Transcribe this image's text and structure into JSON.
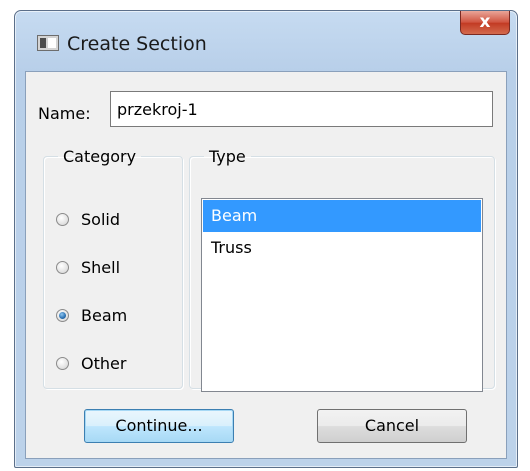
{
  "window": {
    "title": "Create Section",
    "close_label": "x"
  },
  "name_field": {
    "label": "Name:",
    "value": "przekroj-1"
  },
  "category": {
    "legend": "Category",
    "options": [
      {
        "label": "Solid",
        "checked": false
      },
      {
        "label": "Shell",
        "checked": false
      },
      {
        "label": "Beam",
        "checked": true
      },
      {
        "label": "Other",
        "checked": false
      }
    ]
  },
  "type": {
    "legend": "Type",
    "items": [
      {
        "label": "Beam",
        "selected": true
      },
      {
        "label": "Truss",
        "selected": false
      }
    ]
  },
  "buttons": {
    "continue_label": "Continue...",
    "cancel_label": "Cancel"
  },
  "colors": {
    "selection": "#3399ff",
    "close_button": "#c23a23"
  }
}
